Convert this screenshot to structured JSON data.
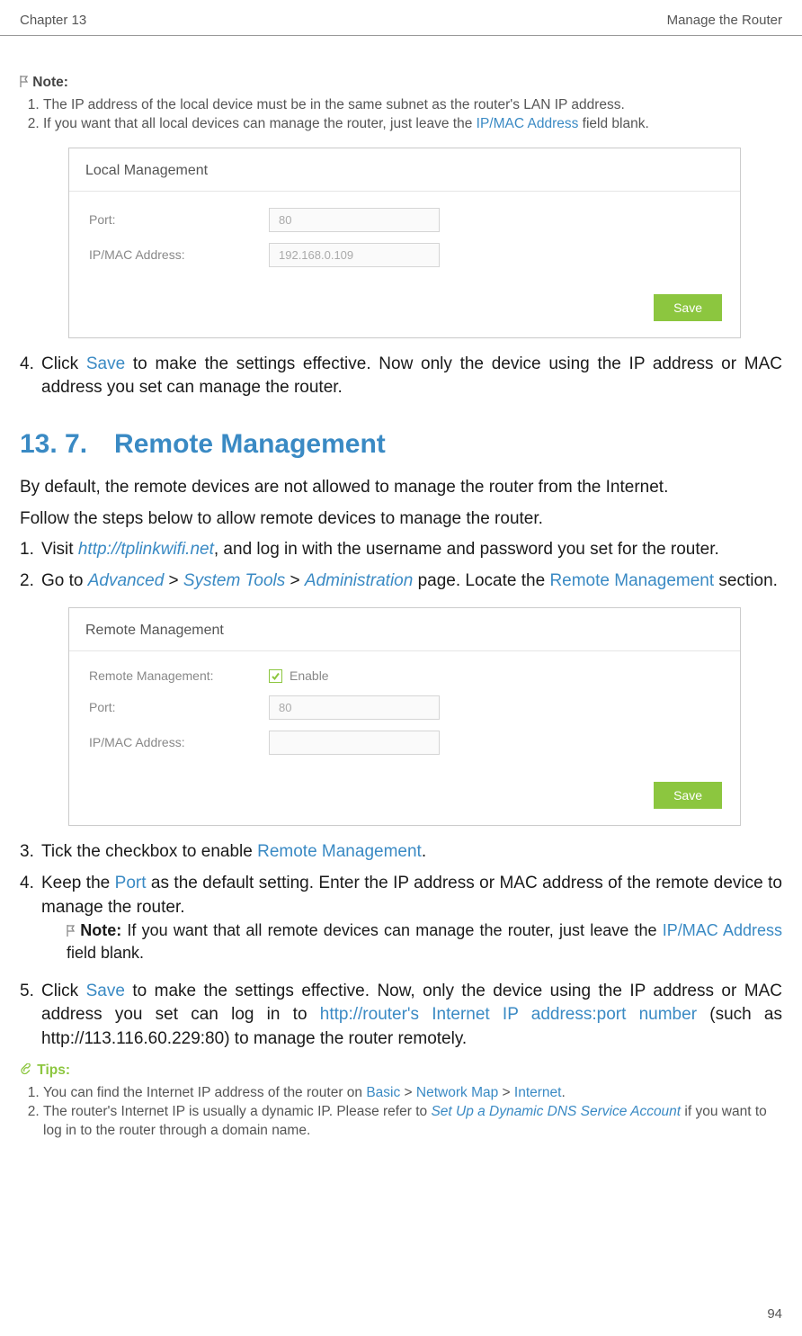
{
  "header": {
    "left": "Chapter 13",
    "right": "Manage the Router"
  },
  "note_label": "Note:",
  "note_items": [
    {
      "pre": "The IP address of the local device must be in the same subnet as the router's LAN IP address.",
      "post": ""
    },
    {
      "pre": "If you want that all local devices can manage the router, just leave the ",
      "link": "IP/MAC Address",
      "post": " field blank."
    }
  ],
  "ui_local": {
    "title": "Local Management",
    "port_label": "Port:",
    "port_value": "80",
    "ipmac_label": "IP/MAC Address:",
    "ipmac_value": "192.168.0.109",
    "save": "Save"
  },
  "step4": {
    "num": "4.",
    "pre": "Click ",
    "save": "Save",
    "post": " to make the settings effective. Now only the device using the IP address or MAC address you set can manage the router."
  },
  "section_title": "13. 7. Remote Management",
  "intro1": "By default, the remote devices are not allowed to manage the router from the Internet.",
  "intro2": "Follow the steps below to allow remote devices to manage the router.",
  "s1": {
    "num": "1.",
    "pre": "Visit ",
    "url": "http://tplinkwifi.net",
    "post": ", and log in with the username and password you set for the router."
  },
  "s2": {
    "num": "2.",
    "pre": "Go to ",
    "a": "Advanced",
    "gt1": " > ",
    "b": "System Tools",
    "gt2": " > ",
    "c": "Administration",
    "mid": " page. Locate the ",
    "rm": "Remote Management",
    "post": " section."
  },
  "ui_remote": {
    "title": "Remote Management",
    "rm_label": "Remote Management:",
    "enable_label": "Enable",
    "port_label": "Port:",
    "port_value": "80",
    "ipmac_label": "IP/MAC Address:",
    "save": "Save"
  },
  "s3": {
    "num": "3.",
    "pre": "Tick the checkbox to enable ",
    "rm": "Remote Management",
    "post": "."
  },
  "s4": {
    "num": "4.",
    "pre": "Keep the ",
    "port": "Port",
    "post": " as the default setting. Enter the IP address or MAC address of the remote device to manage the router."
  },
  "inner_note": {
    "label": "Note:",
    "pre": " If you want that all remote devices can manage the router, just leave the ",
    "link": "IP/MAC Address",
    "post": " field blank."
  },
  "s5": {
    "num": "5.",
    "pre": "Click ",
    "save": "Save",
    "mid": " to make the settings effective. Now, only the device using the IP address or MAC address you set can log in to ",
    "url": "http://router's Internet IP address:port number",
    "post": " (such as http://113.116.60.229:80) to manage the router remotely."
  },
  "tips_label": "Tips:",
  "tips": [
    {
      "pre": "You can find the Internet IP address of the router on ",
      "a": "Basic",
      "gt1": " > ",
      "b": "Network Map",
      "gt2": " > ",
      "c": "Internet",
      "post": "."
    },
    {
      "pre": "The router's Internet IP is usually a dynamic IP. Please refer to ",
      "link": "Set Up a Dynamic DNS Service Account",
      "post": " if you want to log in to the router through a domain name."
    }
  ],
  "page_number": "94"
}
